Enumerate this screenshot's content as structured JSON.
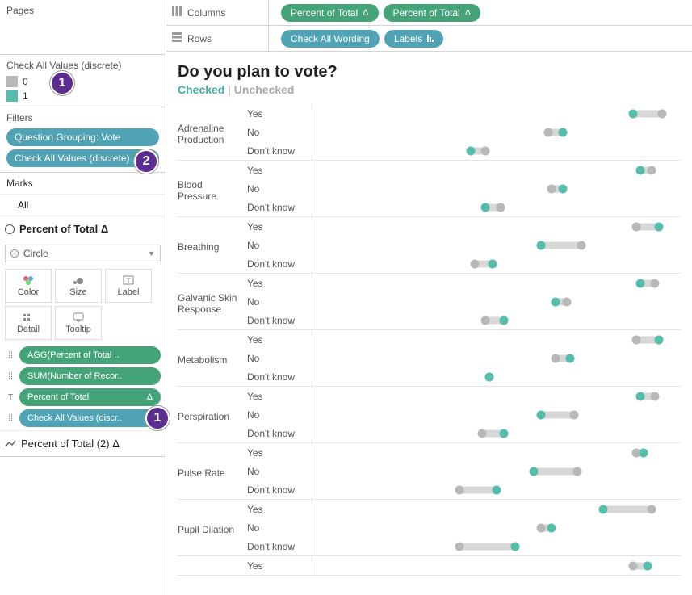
{
  "sidebar": {
    "pages_title": "Pages",
    "legend_title": "Check All Values (discrete)",
    "legend_items": [
      {
        "label": "0",
        "color": "#b8b8b8"
      },
      {
        "label": "1",
        "color": "#55bdaa"
      }
    ],
    "filters_title": "Filters",
    "filters": [
      {
        "label": "Question Grouping: Vote",
        "color": "blue"
      },
      {
        "label": "Check All Values (discrete)",
        "color": "blue"
      }
    ],
    "marks_title": "Marks",
    "marks_all": "All",
    "mark_type_row": "Percent of Total Δ",
    "mark_dropdown": "Circle",
    "mark_buttons": [
      "Color",
      "Size",
      "Label",
      "Detail",
      "Tooltip"
    ],
    "mark_pills": [
      {
        "icon": "⁘",
        "label": "AGG(Percent of Total ..",
        "color": "green"
      },
      {
        "icon": "⁘",
        "label": "SUM(Number of Recor..",
        "color": "green"
      },
      {
        "icon": "T",
        "label": "Percent of Total",
        "color": "green",
        "delta": "Δ"
      },
      {
        "icon": "⁘",
        "label": "Check All Values (discr..",
        "color": "blue"
      }
    ],
    "mark_type_row2": "Percent of Total (2) Δ"
  },
  "shelves": {
    "columns_label": "Columns",
    "columns": [
      {
        "label": "Percent of Total",
        "color": "green",
        "delta": true
      },
      {
        "label": "Percent of Total",
        "color": "green",
        "delta": true
      }
    ],
    "rows_label": "Rows",
    "rows": [
      {
        "label": "Check All Wording",
        "color": "blue"
      },
      {
        "label": "Labels",
        "color": "blue",
        "sort": true
      }
    ]
  },
  "viz": {
    "title": "Do you plan to vote?",
    "sub_checked": "Checked",
    "sub_sep": " | ",
    "sub_unchecked": "Unchecked"
  },
  "chart_data": {
    "type": "dot-plot",
    "row_labels": [
      "Yes",
      "No",
      "Don't know"
    ],
    "x_domain": [
      0,
      100
    ],
    "series_colors": {
      "checked": "#55bdaa",
      "unchecked": "#b8b8b8"
    },
    "groups": [
      {
        "name": "Adrenaline Production",
        "rows": [
          {
            "label": "Yes",
            "checked": 87,
            "unchecked": 95
          },
          {
            "label": "No",
            "checked": 68,
            "unchecked": 64
          },
          {
            "label": "Don't know",
            "checked": 43,
            "unchecked": 47
          }
        ]
      },
      {
        "name": "Blood Pressure",
        "rows": [
          {
            "label": "Yes",
            "checked": 89,
            "unchecked": 92
          },
          {
            "label": "No",
            "checked": 68,
            "unchecked": 65
          },
          {
            "label": "Don't know",
            "checked": 47,
            "unchecked": 51
          }
        ]
      },
      {
        "name": "Breathing",
        "rows": [
          {
            "label": "Yes",
            "checked": 94,
            "unchecked": 88
          },
          {
            "label": "No",
            "checked": 62,
            "unchecked": 73
          },
          {
            "label": "Don't know",
            "checked": 49,
            "unchecked": 44
          }
        ]
      },
      {
        "name": "Galvanic Skin Response",
        "rows": [
          {
            "label": "Yes",
            "checked": 89,
            "unchecked": 93
          },
          {
            "label": "No",
            "checked": 66,
            "unchecked": 69
          },
          {
            "label": "Don't know",
            "checked": 52,
            "unchecked": 47
          }
        ]
      },
      {
        "name": "Metabolism",
        "rows": [
          {
            "label": "Yes",
            "checked": 94,
            "unchecked": 88
          },
          {
            "label": "No",
            "checked": 70,
            "unchecked": 66
          },
          {
            "label": "Don't know",
            "checked": 48,
            "unchecked": 48
          }
        ]
      },
      {
        "name": "Perspiration",
        "rows": [
          {
            "label": "Yes",
            "checked": 89,
            "unchecked": 93
          },
          {
            "label": "No",
            "checked": 62,
            "unchecked": 71
          },
          {
            "label": "Don't know",
            "checked": 52,
            "unchecked": 46
          }
        ]
      },
      {
        "name": "Pulse Rate",
        "rows": [
          {
            "label": "Yes",
            "checked": 90,
            "unchecked": 88
          },
          {
            "label": "No",
            "checked": 60,
            "unchecked": 72
          },
          {
            "label": "Don't know",
            "checked": 50,
            "unchecked": 40
          }
        ]
      },
      {
        "name": "Pupil Dilation",
        "rows": [
          {
            "label": "Yes",
            "checked": 79,
            "unchecked": 92
          },
          {
            "label": "No",
            "checked": 65,
            "unchecked": 62
          },
          {
            "label": "Don't know",
            "checked": 55,
            "unchecked": 40
          }
        ]
      },
      {
        "name": "",
        "rows": [
          {
            "label": "Yes",
            "checked": 91,
            "unchecked": 87
          }
        ]
      }
    ]
  },
  "annotations": {
    "a1": "1",
    "a2": "2"
  }
}
